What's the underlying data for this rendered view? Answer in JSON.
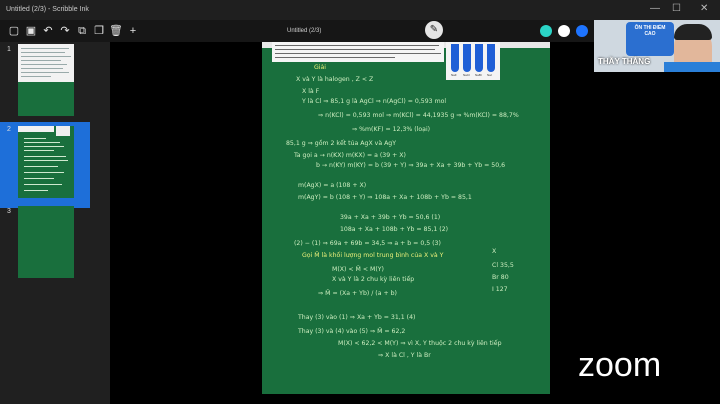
{
  "window": {
    "title": "Untitled (2/3) - Scribble Ink",
    "minimize": "—",
    "maximize": "☐",
    "close": "✕"
  },
  "toolbar": {
    "doc_title": "Untitled (2/3)",
    "icons": [
      "new-page-icon",
      "save-icon",
      "undo-icon",
      "redo-icon",
      "clipboard-icon",
      "copy-icon",
      "delete-icon",
      "add-icon"
    ],
    "icon_glyphs": [
      "▢",
      "▣",
      "↶",
      "↷",
      "⧉",
      "❐",
      "🗑",
      "+"
    ],
    "pen_glyph": "✎",
    "colors": [
      "#2bd4c6",
      "#ffffff",
      "#1e74ff",
      "#1dbf3a",
      "#111111"
    ]
  },
  "sidebar": {
    "slides": [
      {
        "number": "1",
        "selected": false
      },
      {
        "number": "2",
        "selected": true
      },
      {
        "number": "3",
        "selected": false
      }
    ]
  },
  "page": {
    "tube_labels": [
      "NaF",
      "NaCl",
      "NaBr",
      "NaI"
    ],
    "tube_colors": [
      "#1f5fd6",
      "#1f5fd6",
      "#1f5fd6",
      "#1f5fd6"
    ],
    "lines": [
      {
        "text": "Giải",
        "yellow": true
      },
      {
        "text": "X và Y là halogen , Z < Z",
        "yellow": false
      },
      {
        "text": "X là F",
        "yellow": false
      },
      {
        "text": "Y là Cl  ⇒  85,1 g  là  AgCl  ⇒  n(AgCl) = 0,593 mol",
        "yellow": false
      },
      {
        "text": "⇒  n(KCl) = 0,593 mol  ⇒  m(KCl) = 44,1935 g  ⇒ %m(KCl) = 88,7%",
        "yellow": false
      },
      {
        "text": "⇒ %m(KF) = 12,3%   (loại)",
        "yellow": false
      },
      {
        "text": "85,1 g  ⇒ gồm 2 kết tủa AgX  và  AgY",
        "yellow": false
      },
      {
        "text": "Ta gọi  a → n(KX)     m(KX) = a (39 + X)",
        "yellow": false
      },
      {
        "text": "b → n(KY)     m(KY) = b (39 + Y)   ⇒  39a + Xa + 39b + Yb = 50,6",
        "yellow": false
      },
      {
        "text": "m(AgX) = a (108 + X)",
        "yellow": false
      },
      {
        "text": "m(AgY) = b (108 + Y)   ⇒  108a + Xa + 108b + Yb = 85,1",
        "yellow": false
      },
      {
        "text": "39a + Xa + 39b + Yb = 50,6   (1)",
        "yellow": false
      },
      {
        "text": "108a + Xa + 108b + Yb = 85,1   (2)",
        "yellow": false
      },
      {
        "text": "(2) − (1)  ⇒  69a + 69b = 34,5  ⇒  a + b = 0,5   (3)",
        "yellow": false
      },
      {
        "text": "Gọi  M̄  là khối lượng mol trung bình của X và Y",
        "yellow": true
      },
      {
        "text": "M(X) < M̄ < M(Y)",
        "yellow": false
      },
      {
        "text": "X và Y là 2 chu kỳ liên tiếp",
        "yellow": false
      },
      {
        "text": "⇒  M̄ = (Xa + Yb) / (a + b)",
        "yellow": false
      },
      {
        "text": "Thay (3) vào (1)  ⇒  Xa + Yb = 31,1   (4)",
        "yellow": false
      },
      {
        "text": "Thay (3) và (4) vào (5)  ⇒  M̄ = 62,2",
        "yellow": false
      },
      {
        "text": "M(X) < 62,2 < M(Y)  ⇒  vì X, Y thuộc 2 chu kỳ liên tiếp",
        "yellow": false
      },
      {
        "text": "⇒  X là Cl ,  Y là Br",
        "yellow": false
      }
    ],
    "side_notes": [
      "X",
      "Cl  35,5",
      "Br  80",
      "I  127"
    ]
  },
  "webcam": {
    "sign_text": "ÔN THI ĐIỂM CAO",
    "name": "THẦY THẮNG"
  },
  "zoom": {
    "logo": "zoom"
  }
}
